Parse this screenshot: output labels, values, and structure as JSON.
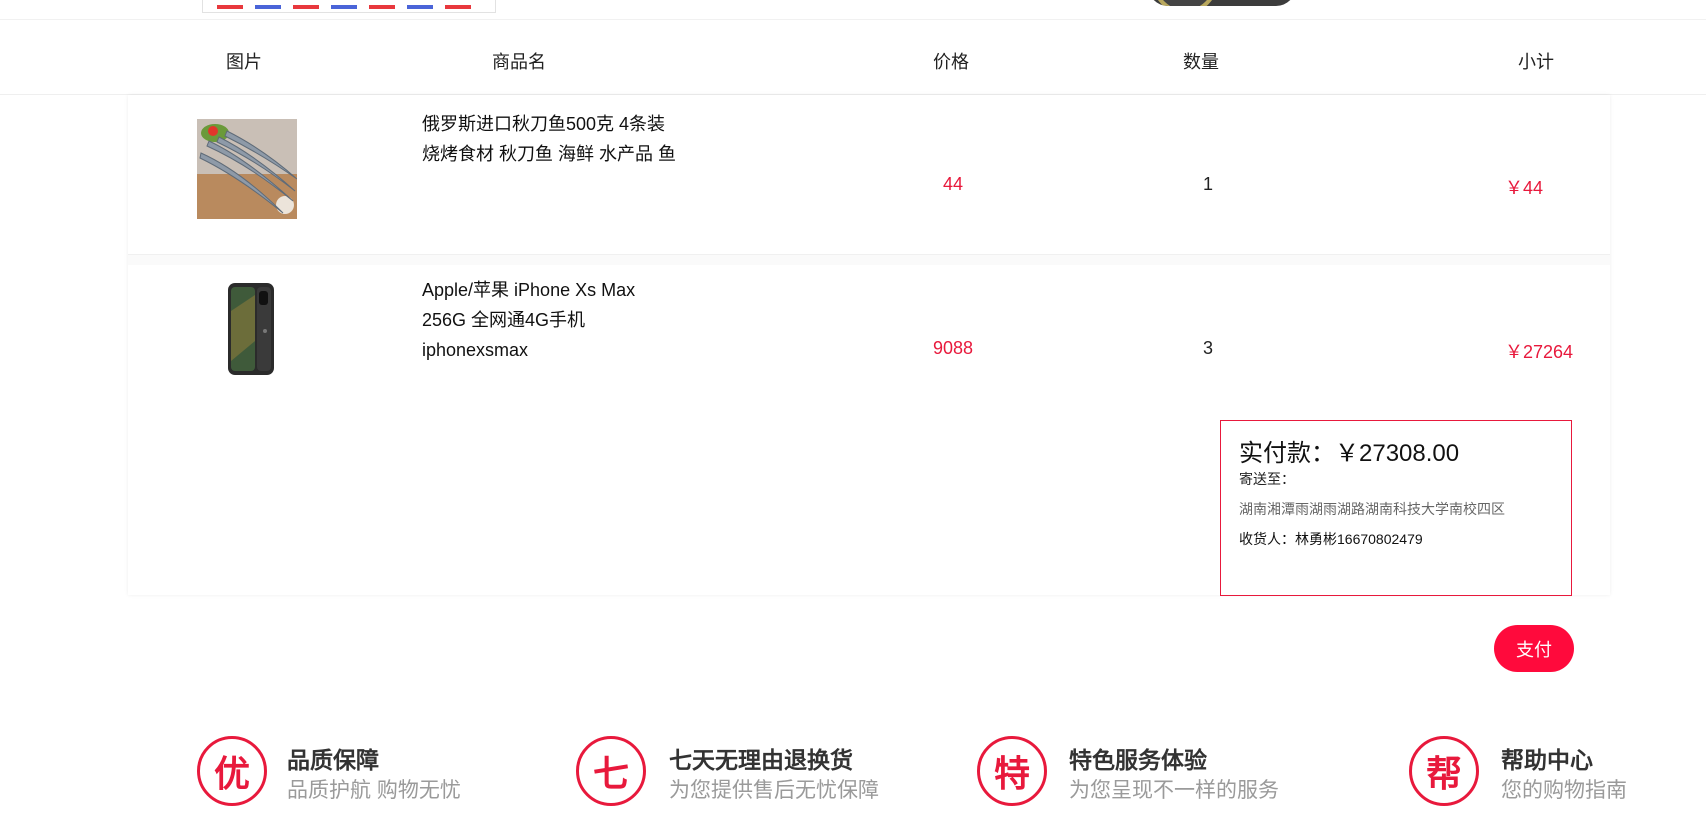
{
  "header": {
    "col_image": "图片",
    "col_name": "商品名",
    "col_price": "价格",
    "col_qty": "数量",
    "col_subtotal": "小计"
  },
  "items": [
    {
      "name_line1": "俄罗斯进口秋刀鱼500克 4条装",
      "name_line2": "烧烤食材 秋刀鱼 海鲜 水产品 鱼",
      "name_line3": "",
      "price": "44",
      "qty": "1",
      "subtotal": "￥44"
    },
    {
      "name_line1": "Apple/苹果 iPhone Xs Max",
      "name_line2": "256G 全网通4G手机",
      "name_line3": "iphonexsmax",
      "price": "9088",
      "qty": "3",
      "subtotal": "￥27264"
    }
  ],
  "summary": {
    "total_label": "实付款：",
    "total_value": "￥27308.00",
    "ship_label": "寄送至：",
    "address": "湖南湘潭雨湖雨湖路湖南科技大学南校四区",
    "receiver_label": "收货人：",
    "receiver": "林勇彬16670802479"
  },
  "pay_button": "支付",
  "features": [
    {
      "icon_char": "优",
      "title": "品质保障",
      "subtitle": "品质护航 购物无忧"
    },
    {
      "icon_char": "七",
      "title": "七天无理由退换货",
      "subtitle": "为您提供售后无忧保障"
    },
    {
      "icon_char": "特",
      "title": "特色服务体验",
      "subtitle": "为您呈现不一样的服务"
    },
    {
      "icon_char": "帮",
      "title": "帮助中心",
      "subtitle": "您的购物指南"
    }
  ],
  "colors": {
    "accent": "#e8193c",
    "pay_button": "#ff0a3c"
  }
}
